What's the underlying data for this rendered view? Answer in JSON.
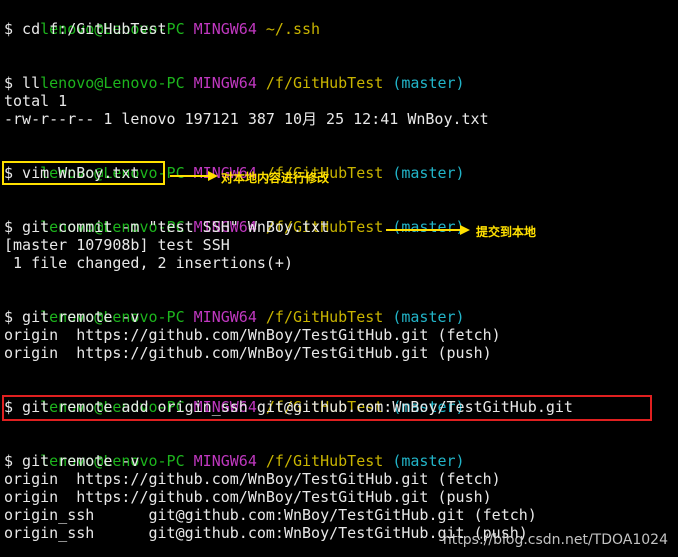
{
  "prompt_user": "lenovo@Lenovo-PC",
  "prompt_system": "MINGW64",
  "prompt_branch": "(master)",
  "blocks": [
    {
      "path": "~/.ssh",
      "cmd": "$ cd f:/GitHubTest",
      "output": []
    },
    {
      "path": "/f/GitHubTest",
      "cmd": "$ ll",
      "output": [
        "total 1",
        "-rw-r--r-- 1 lenovo 197121 387 10月 25 12:41 WnBoy.txt"
      ]
    },
    {
      "path": "/f/GitHubTest",
      "cmd": "$ vim WnBoy.txt",
      "output": []
    },
    {
      "path": "/f/GitHubTest",
      "cmd": "$ git commit -m \"test SSH\" WnBoy.txt",
      "output": [
        "[master 107908b] test SSH",
        " 1 file changed, 2 insertions(+)"
      ]
    },
    {
      "path": "/f/GitHubTest",
      "cmd": "$ git remote -v",
      "output": [
        "origin  https://github.com/WnBoy/TestGitHub.git (fetch)",
        "origin  https://github.com/WnBoy/TestGitHub.git (push)"
      ]
    },
    {
      "path": "/f/GitHubTest",
      "cmd": "$ git remote add origin_ssh git@github.com:WnBoy/TestGitHub.git",
      "output": []
    },
    {
      "path": "/f/GitHubTest",
      "cmd": "$ git remote -v",
      "output": [
        "origin  https://github.com/WnBoy/TestGitHub.git (fetch)",
        "origin  https://github.com/WnBoy/TestGitHub.git (push)",
        "origin_ssh      git@github.com:WnBoy/TestGitHub.git (fetch)",
        "origin_ssh      git@github.com:WnBoy/TestGitHub.git (push)"
      ]
    }
  ],
  "annotations": {
    "vim_note": "对本地内容进行修改",
    "commit_note": "提交到本地"
  },
  "watermark": "https://blog.csdn.net/TDOA1024",
  "colors": {
    "user": "#1db51d",
    "system": "#c038c0",
    "path": "#c8b400",
    "branch": "#22b4c8",
    "highlight_yellow": "#ffe000",
    "highlight_red": "#e02020"
  }
}
